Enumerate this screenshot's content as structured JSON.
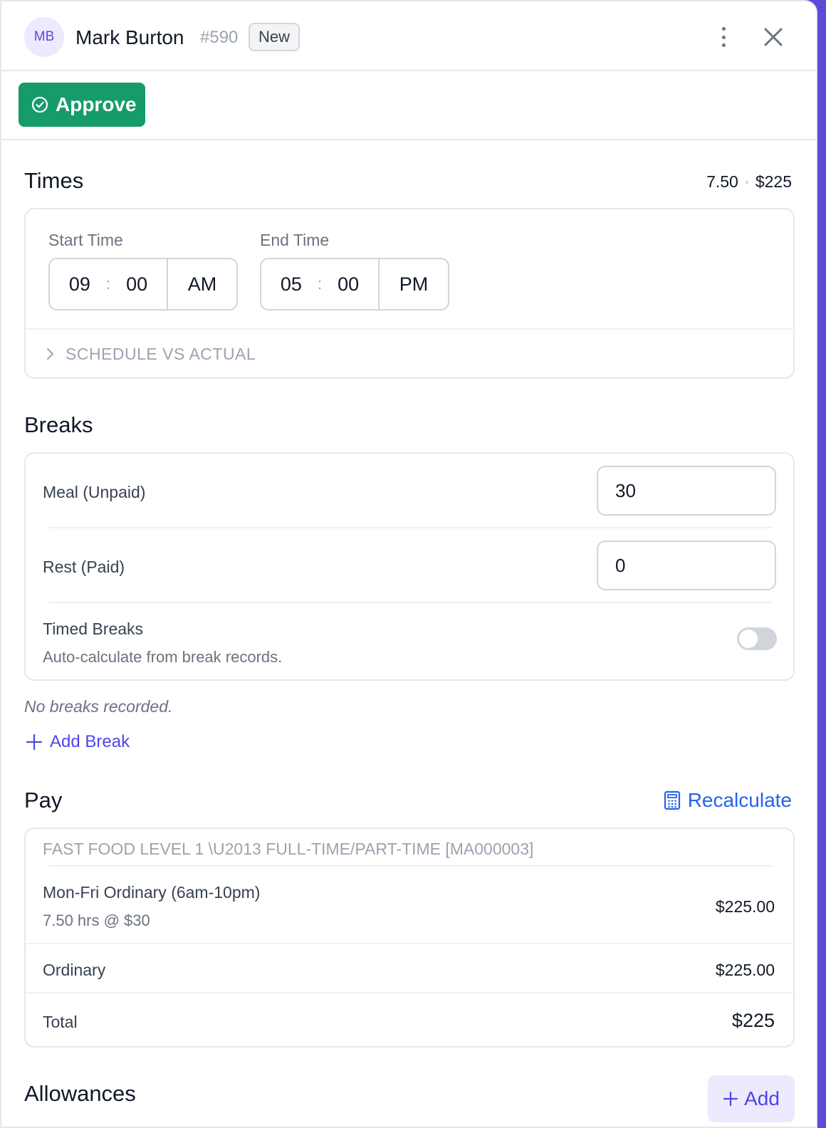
{
  "header": {
    "initials": "MB",
    "name": "Mark Burton",
    "ticket": "#590",
    "status": "New"
  },
  "actions": {
    "approve_label": "Approve"
  },
  "times": {
    "title": "Times",
    "summary_hours": "7.50",
    "summary_pay": "$225",
    "start_label": "Start Time",
    "start_hour": "09",
    "start_minute": "00",
    "start_ampm": "AM",
    "end_label": "End Time",
    "end_hour": "05",
    "end_minute": "00",
    "end_ampm": "PM",
    "colon": ":",
    "schedule_toggle": "SCHEDULE VS ACTUAL"
  },
  "breaks": {
    "title": "Breaks",
    "meal_label": "Meal (Unpaid)",
    "meal_value": "30",
    "rest_label": "Rest (Paid)",
    "rest_value": "0",
    "timed_label": "Timed Breaks",
    "timed_desc": "Auto-calculate from break records.",
    "timed_enabled": false,
    "empty_text": "No breaks recorded.",
    "add_label": "Add Break"
  },
  "pay": {
    "title": "Pay",
    "recalc_label": "Recalculate",
    "award": "FAST FOOD LEVEL 1 \\U2013 FULL-TIME/PART-TIME [MA000003]",
    "line_name": "Mon-Fri Ordinary (6am-10pm)",
    "line_detail": "7.50 hrs @ $30",
    "line_amount": "$225.00",
    "ordinary_label": "Ordinary",
    "ordinary_amount": "$225.00",
    "total_label": "Total",
    "total_amount": "$225"
  },
  "allowances": {
    "title": "Allowances",
    "add_label": "Add"
  },
  "colors": {
    "accent": "#4f46e5",
    "approve": "#169b6b",
    "link_blue": "#2563eb",
    "frame": "#5b4bd6"
  }
}
